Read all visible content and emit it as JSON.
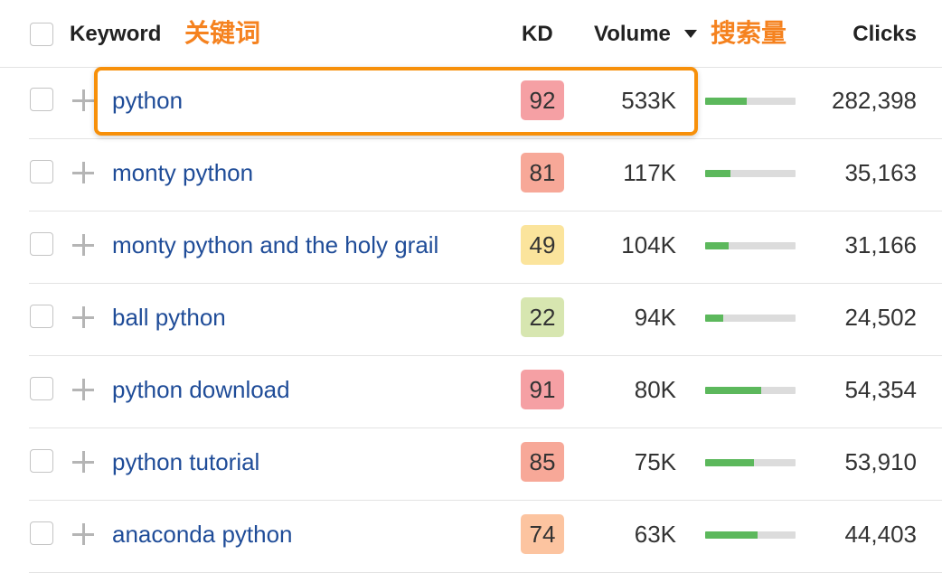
{
  "header": {
    "keyword_label": "Keyword",
    "keyword_annotation": "关键词",
    "kd_label": "KD",
    "volume_label": "Volume",
    "volume_annotation": "搜索量",
    "clicks_label": "Clicks"
  },
  "colors": {
    "annotation": "#f5821f",
    "highlight_border": "#f7900a",
    "keyword_link": "#1f4c98",
    "volume_bar_fill": "#5cb85c",
    "kd_very_hard": "#f5a0a4",
    "kd_hard": "#f9b0a0",
    "kd_medium": "#fbe49c",
    "kd_easy": "#d7e6b0",
    "kd_hard_orange": "#fcc4a0"
  },
  "rows": [
    {
      "keyword": "python",
      "kd": "92",
      "kd_color": "#f5a0a4",
      "volume": "533K",
      "volume_fraction": 0.46,
      "clicks": "282,398",
      "highlighted": true
    },
    {
      "keyword": "monty python",
      "kd": "81",
      "kd_color": "#f7a898",
      "volume": "117K",
      "volume_fraction": 0.28,
      "clicks": "35,163"
    },
    {
      "keyword": "monty python and the holy grail",
      "kd": "49",
      "kd_color": "#fbe49c",
      "volume": "104K",
      "volume_fraction": 0.26,
      "clicks": "31,166"
    },
    {
      "keyword": "ball python",
      "kd": "22",
      "kd_color": "#d7e6b0",
      "volume": "94K",
      "volume_fraction": 0.2,
      "clicks": "24,502"
    },
    {
      "keyword": "python download",
      "kd": "91",
      "kd_color": "#f5a0a4",
      "volume": "80K",
      "volume_fraction": 0.62,
      "clicks": "54,354"
    },
    {
      "keyword": "python tutorial",
      "kd": "85",
      "kd_color": "#f7a898",
      "volume": "75K",
      "volume_fraction": 0.54,
      "clicks": "53,910"
    },
    {
      "keyword": "anaconda python",
      "kd": "74",
      "kd_color": "#fcc4a0",
      "volume": "63K",
      "volume_fraction": 0.58,
      "clicks": "44,403"
    }
  ]
}
